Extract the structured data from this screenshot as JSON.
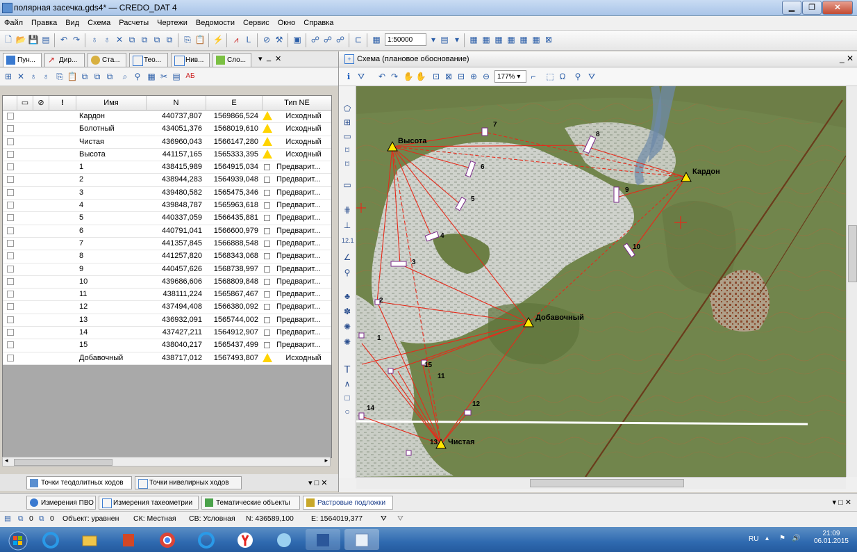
{
  "window": {
    "title": "полярная засечка.gds4* — CREDO_DAT 4"
  },
  "menu": [
    "Файл",
    "Правка",
    "Вид",
    "Схема",
    "Расчеты",
    "Чертежи",
    "Ведомости",
    "Сервис",
    "Окно",
    "Справка"
  ],
  "toolbar": {
    "scale": "1:50000"
  },
  "left_tabs": [
    "Пун...",
    "Дир...",
    "Ста...",
    "Тео...",
    "Нив...",
    "Сло..."
  ],
  "grid": {
    "columns": [
      "Имя",
      "N",
      "E",
      "Тип NE"
    ],
    "rows": [
      {
        "name": "Кардон",
        "n": "440737,807",
        "e": "1569866,524",
        "type": "Исходный",
        "kind": "source"
      },
      {
        "name": "Болотный",
        "n": "434051,376",
        "e": "1568019,610",
        "type": "Исходный",
        "kind": "source"
      },
      {
        "name": "Чистая",
        "n": "436960,043",
        "e": "1566147,280",
        "type": "Исходный",
        "kind": "source"
      },
      {
        "name": "Высота",
        "n": "441157,165",
        "e": "1565333,395",
        "type": "Исходный",
        "kind": "source"
      },
      {
        "name": "1",
        "n": "438415,989",
        "e": "1564915,034",
        "type": "Предварит...",
        "kind": "pre"
      },
      {
        "name": "2",
        "n": "438944,283",
        "e": "1564939,048",
        "type": "Предварит...",
        "kind": "pre"
      },
      {
        "name": "3",
        "n": "439480,582",
        "e": "1565475,346",
        "type": "Предварит...",
        "kind": "pre"
      },
      {
        "name": "4",
        "n": "439848,787",
        "e": "1565963,618",
        "type": "Предварит...",
        "kind": "pre"
      },
      {
        "name": "5",
        "n": "440337,059",
        "e": "1566435,881",
        "type": "Предварит...",
        "kind": "pre"
      },
      {
        "name": "6",
        "n": "440791,041",
        "e": "1566600,979",
        "type": "Предварит...",
        "kind": "pre"
      },
      {
        "name": "7",
        "n": "441357,845",
        "e": "1566888,548",
        "type": "Предварит...",
        "kind": "pre"
      },
      {
        "name": "8",
        "n": "441257,820",
        "e": "1568343,068",
        "type": "Предварит...",
        "kind": "pre"
      },
      {
        "name": "9",
        "n": "440457,626",
        "e": "1568738,997",
        "type": "Предварит...",
        "kind": "pre"
      },
      {
        "name": "10",
        "n": "439686,606",
        "e": "1568809,848",
        "type": "Предварит...",
        "kind": "pre"
      },
      {
        "name": "11",
        "n": "438111,224",
        "e": "1565867,467",
        "type": "Предварит...",
        "kind": "pre"
      },
      {
        "name": "12",
        "n": "437494,408",
        "e": "1566380,092",
        "type": "Предварит...",
        "kind": "pre"
      },
      {
        "name": "13",
        "n": "436932,091",
        "e": "1565744,002",
        "type": "Предварит...",
        "kind": "pre"
      },
      {
        "name": "14",
        "n": "437427,211",
        "e": "1564912,907",
        "type": "Предварит...",
        "kind": "pre"
      },
      {
        "name": "15",
        "n": "438040,217",
        "e": "1565437,499",
        "type": "Предварит...",
        "kind": "pre"
      },
      {
        "name": "Добавочный",
        "n": "438717,012",
        "e": "1567493,807",
        "type": "Исходный",
        "kind": "source"
      }
    ]
  },
  "left_bottom_tabs": [
    "Точки теодолитных ходов",
    "Точки нивелирных ходов"
  ],
  "scheme": {
    "title": "Схема (плановое обоснование)",
    "zoom": "177%"
  },
  "map_labels": {
    "stations": [
      "Высота",
      "Кардон",
      "Добавочный",
      "Чистая"
    ],
    "points": [
      "1",
      "2",
      "3",
      "4",
      "5",
      "6",
      "7",
      "8",
      "9",
      "10",
      "11",
      "12",
      "13",
      "14",
      "15"
    ]
  },
  "bottom_tabs": [
    "Измерения ПВО",
    "Измерения тахеометрии",
    "Тематические объекты",
    "Растровые подложки"
  ],
  "status": {
    "c1": "0",
    "c2": "0",
    "object": "Объект: уравнен",
    "sk": "СК: Местная",
    "sv": "СВ: Условная",
    "n": "N: 436589,100",
    "e": "E: 1564019,377"
  },
  "tray": {
    "lang": "RU",
    "time": "21:09",
    "date": "06.01.2015"
  },
  "colors": {
    "accent": "#2b5ea8",
    "map_lines": "#e02020",
    "station": "#ffe600"
  }
}
